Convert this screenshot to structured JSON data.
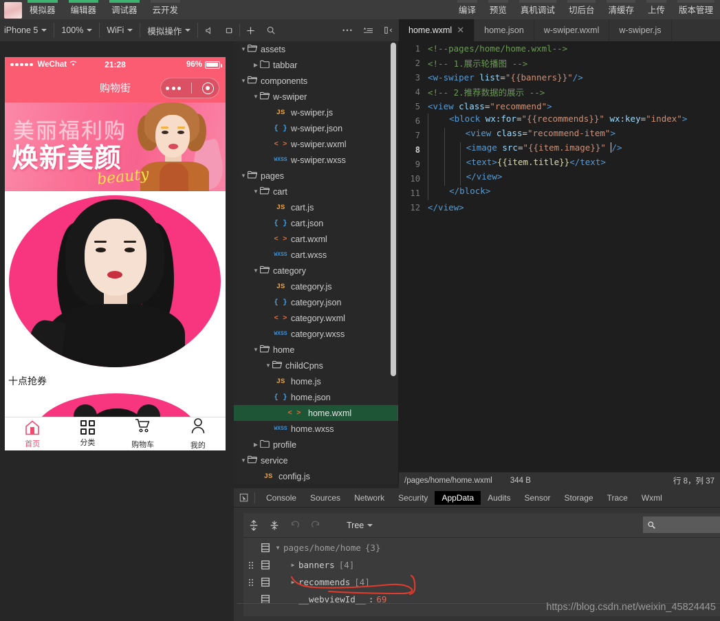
{
  "titlebar": {
    "left_menu": [
      {
        "label": "模拟器",
        "active": true
      },
      {
        "label": "编辑器",
        "active": true
      },
      {
        "label": "调试器",
        "active": true
      },
      {
        "label": "云开发",
        "active": false
      }
    ],
    "right_menu": [
      {
        "label": "编译"
      },
      {
        "label": "预览"
      },
      {
        "label": "真机调试"
      },
      {
        "label": "切后台"
      },
      {
        "label": "清缓存"
      },
      {
        "label": "上传"
      },
      {
        "label": "版本管理"
      }
    ],
    "accent_green": "#3eb370"
  },
  "sim_toolbar": {
    "device": "iPhone 5",
    "zoom": "100%",
    "network": "WiFi",
    "action": "模拟操作",
    "icons": [
      "volume-icon",
      "rotate-icon",
      "add-icon",
      "search-icon",
      "more-icon",
      "list-icon",
      "panel-collapse-icon"
    ]
  },
  "editor_tabs": [
    {
      "label": "home.wxml",
      "active": true,
      "closable": true
    },
    {
      "label": "home.json",
      "active": false,
      "closable": false
    },
    {
      "label": "w-swiper.wxml",
      "active": false,
      "closable": false
    },
    {
      "label": "w-swiper.js",
      "active": false,
      "closable": false
    }
  ],
  "simulator": {
    "status_bar": {
      "carrier": "WeChat",
      "time": "21:28",
      "battery": "96%"
    },
    "nav_title": "购物街",
    "banner": {
      "line1": "美丽福利购",
      "line2": "焕新美颜",
      "line3": "beauty"
    },
    "promo_text": "十点抢券",
    "tabbar": [
      {
        "label": "首页",
        "icon": "home-icon",
        "active": true
      },
      {
        "label": "分类",
        "icon": "grid-icon",
        "active": false
      },
      {
        "label": "购物车",
        "icon": "cart-icon",
        "active": false
      },
      {
        "label": "我的",
        "icon": "person-icon",
        "active": false
      }
    ],
    "theme_pink": "#fb5c72"
  },
  "file_tree": [
    {
      "label": "assets",
      "type": "folder",
      "depth": 0,
      "expanded": true
    },
    {
      "label": "tabbar",
      "type": "folder",
      "depth": 1,
      "expanded": false
    },
    {
      "label": "components",
      "type": "folder",
      "depth": 0,
      "expanded": true
    },
    {
      "label": "w-swiper",
      "type": "folder",
      "depth": 1,
      "expanded": true
    },
    {
      "label": "w-swiper.js",
      "type": "js",
      "depth": 2
    },
    {
      "label": "w-swiper.json",
      "type": "json",
      "depth": 2
    },
    {
      "label": "w-swiper.wxml",
      "type": "wxml",
      "depth": 2
    },
    {
      "label": "w-swiper.wxss",
      "type": "wxss",
      "depth": 2
    },
    {
      "label": "pages",
      "type": "folder",
      "depth": 0,
      "expanded": true
    },
    {
      "label": "cart",
      "type": "folder",
      "depth": 1,
      "expanded": true
    },
    {
      "label": "cart.js",
      "type": "js",
      "depth": 2
    },
    {
      "label": "cart.json",
      "type": "json",
      "depth": 2
    },
    {
      "label": "cart.wxml",
      "type": "wxml",
      "depth": 2
    },
    {
      "label": "cart.wxss",
      "type": "wxss",
      "depth": 2
    },
    {
      "label": "category",
      "type": "folder",
      "depth": 1,
      "expanded": true
    },
    {
      "label": "category.js",
      "type": "js",
      "depth": 2
    },
    {
      "label": "category.json",
      "type": "json",
      "depth": 2
    },
    {
      "label": "category.wxml",
      "type": "wxml",
      "depth": 2
    },
    {
      "label": "category.wxss",
      "type": "wxss",
      "depth": 2
    },
    {
      "label": "home",
      "type": "folder",
      "depth": 1,
      "expanded": true
    },
    {
      "label": "childCpns",
      "type": "folder",
      "depth": 2,
      "expanded": true
    },
    {
      "label": "home.js",
      "type": "js",
      "depth": 2
    },
    {
      "label": "home.json",
      "type": "json",
      "depth": 2
    },
    {
      "label": "home.wxml",
      "type": "wxml",
      "depth": 2,
      "selected": true
    },
    {
      "label": "home.wxss",
      "type": "wxss",
      "depth": 2
    },
    {
      "label": "profile",
      "type": "folder",
      "depth": 1,
      "expanded": false
    },
    {
      "label": "service",
      "type": "folder",
      "depth": 0,
      "expanded": true
    },
    {
      "label": "config.js",
      "type": "js",
      "depth": 1
    }
  ],
  "code": {
    "lines": [
      {
        "n": "1",
        "current": false
      },
      {
        "n": "2",
        "current": false
      },
      {
        "n": "3",
        "current": false
      },
      {
        "n": "4",
        "current": false
      },
      {
        "n": "5",
        "current": false
      },
      {
        "n": "6",
        "current": false
      },
      {
        "n": "7",
        "current": false
      },
      {
        "n": "8",
        "current": true
      },
      {
        "n": "9",
        "current": false
      },
      {
        "n": "10",
        "current": false
      },
      {
        "n": "11",
        "current": false
      },
      {
        "n": "12",
        "current": false
      }
    ],
    "text": {
      "l1": "<!--pages/home/home.wxml-->",
      "l2": "<!-- 1.展示轮播图 -->",
      "l3_tag_open": "<w-swiper",
      "l3_attr": "list",
      "l3_val": "\"{{banners}}\"",
      "l3_close": "/>",
      "l4": "<!-- 2.推荐数据的展示 -->",
      "l5_tag_open": "<view",
      "l5_attr": "class",
      "l5_val": "\"recommend\"",
      "l5_gt": ">",
      "l6_tag_open": "<block",
      "l6_attr1": "wx:for",
      "l6_val1": "\"{{recommends}}\"",
      "l6_attr2": "wx:key",
      "l6_val2": "\"index\"",
      "l6_gt": ">",
      "l7_tag_open": "<view",
      "l7_attr": "class",
      "l7_val": "\"recommend-item\"",
      "l7_gt": ">",
      "l8_tag_open": "<image",
      "l8_attr": "src",
      "l8_val": "\"{{item.image}}\"",
      "l8_close": "/>",
      "l9_tag_open": "<text>",
      "l9_mus": "{{item.title}}",
      "l9_tag_close": "</text>",
      "l10": "</view>",
      "l11": "</block>",
      "l12": "</view>"
    }
  },
  "editor_status": {
    "path": "/pages/home/home.wxml",
    "size": "344 B",
    "position": "行 8，列 37"
  },
  "devtools": {
    "tabs": [
      {
        "label": "Console",
        "active": false
      },
      {
        "label": "Sources",
        "active": false
      },
      {
        "label": "Network",
        "active": false
      },
      {
        "label": "Security",
        "active": false
      },
      {
        "label": "AppData",
        "active": true
      },
      {
        "label": "Audits",
        "active": false
      },
      {
        "label": "Sensor",
        "active": false
      },
      {
        "label": "Storage",
        "active": false
      },
      {
        "label": "Trace",
        "active": false
      },
      {
        "label": "Wxml",
        "active": false
      }
    ],
    "appdata": {
      "mode": "Tree",
      "search_placeholder": "",
      "rows": [
        {
          "key": "pages/home/home",
          "count": "{3}",
          "depth": 0,
          "handle": false,
          "expanded": true,
          "grey": true
        },
        {
          "key": "banners",
          "count": "[4]",
          "depth": 1,
          "handle": true,
          "expanded": false
        },
        {
          "key": "recommends",
          "count": "[4]",
          "depth": 1,
          "handle": true,
          "expanded": false
        },
        {
          "key": "__webviewId__",
          "value": "69",
          "depth": 1,
          "handle": false,
          "leaf": true
        }
      ]
    }
  },
  "watermark": "https://blog.csdn.net/weixin_45824445"
}
